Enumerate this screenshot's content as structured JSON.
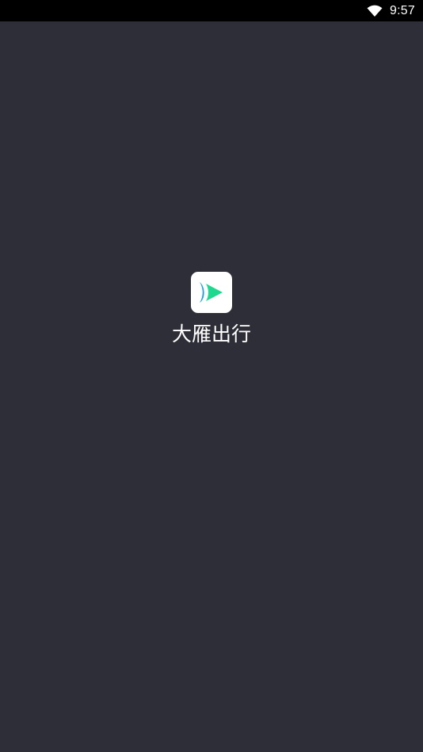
{
  "status_bar": {
    "time": "9:57",
    "wifi_icon": "wifi-icon"
  },
  "splash": {
    "logo_icon": "app-logo-icon",
    "app_name": "大雁出行",
    "background_color": "#2e2e38",
    "logo_colors": {
      "blue": "#1a9ee6",
      "green": "#1fd88f"
    }
  }
}
